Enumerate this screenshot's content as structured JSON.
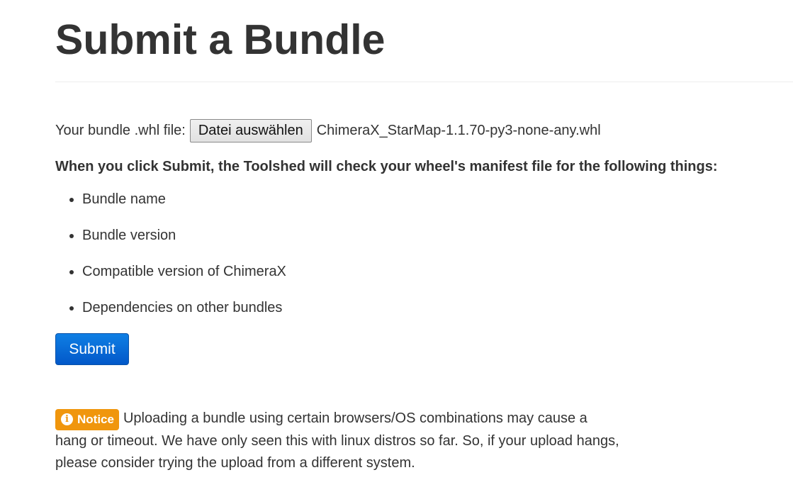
{
  "page": {
    "title": "Submit a Bundle"
  },
  "file_upload": {
    "label": "Your bundle .whl file:",
    "button_label": "Datei auswählen",
    "selected_file": "ChimeraX_StarMap-1.1.70-py3-none-any.whl"
  },
  "checks": {
    "heading": "When you click Submit, the Toolshed will check your wheel's manifest file for the following things:",
    "items": [
      "Bundle name",
      "Bundle version",
      "Compatible version of ChimeraX",
      "Dependencies on other bundles"
    ]
  },
  "actions": {
    "submit_label": "Submit"
  },
  "notice": {
    "badge_label": "Notice",
    "badge_icon": "info-icon",
    "text": "Uploading a bundle using certain browsers/OS combinations may cause a hang or timeout. We have only seen this with linux distros so far. So, if your upload hangs, please consider trying the upload from a different system."
  },
  "colors": {
    "text": "#333333",
    "submit_button": "#0f7fe4",
    "notice_badge": "#f0960d"
  }
}
